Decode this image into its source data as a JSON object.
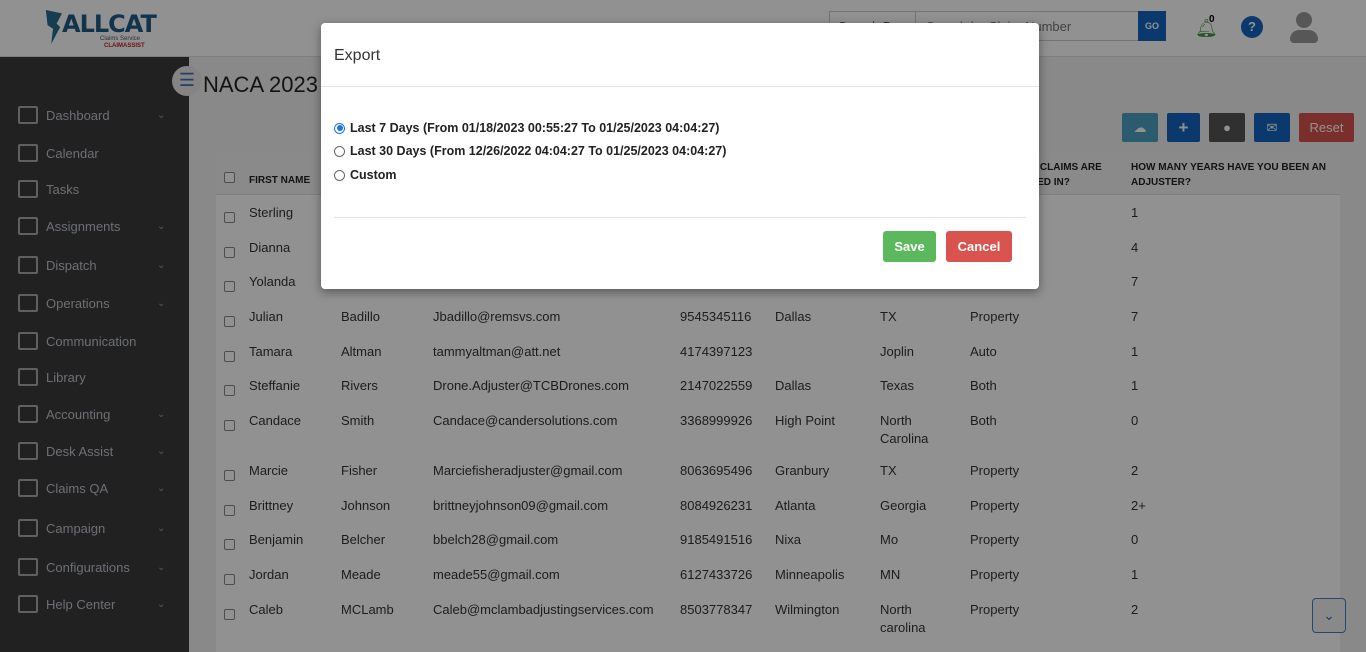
{
  "header": {
    "logo_text": "ALLCAT",
    "logo_sub": "Claims Service",
    "logo_sub2": "CLAIMASSIST",
    "search_by": "Search By",
    "search_placeholder": "Search by Claim Number",
    "go_label": "GO",
    "notification_count": "0",
    "help_label": "?"
  },
  "sidebar": {
    "items": [
      {
        "label": "Dashboard",
        "chevron": true,
        "icon": "dashboard-icon"
      },
      {
        "label": "Calendar",
        "chevron": false,
        "icon": "calendar-icon"
      },
      {
        "label": "Tasks",
        "chevron": false,
        "icon": "tasks-icon"
      },
      {
        "label": "Assignments",
        "chevron": true,
        "icon": "clipboard-icon"
      },
      {
        "label": "Dispatch",
        "chevron": true,
        "icon": "dispatch-icon"
      },
      {
        "label": "Operations",
        "chevron": true,
        "icon": "operations-icon"
      },
      {
        "label": "Communication",
        "chevron": false,
        "icon": "globe-icon"
      },
      {
        "label": "Library",
        "chevron": false,
        "icon": "library-icon"
      },
      {
        "label": "Accounting",
        "chevron": true,
        "icon": "accounting-icon"
      },
      {
        "label": "Desk Assist",
        "chevron": true,
        "icon": "desk-icon"
      },
      {
        "label": "Claims QA",
        "chevron": true,
        "icon": "claims-qa-icon"
      },
      {
        "label": "Campaign",
        "chevron": true,
        "icon": "megaphone-icon"
      },
      {
        "label": "Configurations",
        "chevron": true,
        "icon": "gear-icon"
      },
      {
        "label": "Help Center",
        "chevron": true,
        "icon": "help-icon"
      }
    ]
  },
  "main": {
    "title": "NACA 2023",
    "reset_label": "Reset",
    "columns": [
      "FIRST NAME",
      "F CLAIMS ARE",
      "TED IN?",
      "HOW MANY YEARS HAVE YOU BEEN AN",
      "ADJUSTER?"
    ],
    "rows": [
      {
        "first": "Sterling",
        "last": "",
        "email": "",
        "phone": "",
        "city": "",
        "state": "",
        "type": "",
        "years": "1"
      },
      {
        "first": "Dianna",
        "last": "",
        "email": "",
        "phone": "",
        "city": "",
        "state": "",
        "type": "",
        "years": "4"
      },
      {
        "first": "Yolanda",
        "last": "",
        "email": "",
        "phone": "",
        "city": "",
        "state": "",
        "type": "",
        "years": "7"
      },
      {
        "first": "Julian",
        "last": "Badillo",
        "email": "Jbadillo@remsvs.com",
        "phone": "9545345116",
        "city": "Dallas",
        "state": "TX",
        "type": "Property",
        "years": "7"
      },
      {
        "first": "Tamara",
        "last": "Altman",
        "email": "tammyaltman@att.net",
        "phone": "4174397123",
        "city": "",
        "state": "Joplin",
        "type": "Auto",
        "years": "1"
      },
      {
        "first": "Steffanie",
        "last": "Rivers",
        "email": "Drone.Adjuster@TCBDrones.com",
        "phone": "2147022559",
        "city": "Dallas",
        "state": "Texas",
        "type": "Both",
        "years": "1"
      },
      {
        "first": "Candace",
        "last": "Smith",
        "email": "Candace@candersolutions.com",
        "phone": "3368999926",
        "city": "High Point",
        "state": "North Carolina",
        "type": "Both",
        "years": "0"
      },
      {
        "first": "Marcie",
        "last": "Fisher",
        "email": "Marciefisheradjuster@gmail.com",
        "phone": "8063695496",
        "city": "Granbury",
        "state": "TX",
        "type": "Property",
        "years": "2"
      },
      {
        "first": "Brittney",
        "last": "Johnson",
        "email": "brittneyjohnson09@gmail.com",
        "phone": "8084926231",
        "city": "Atlanta",
        "state": "Georgia",
        "type": "Property",
        "years": "2+"
      },
      {
        "first": "Benjamin",
        "last": "Belcher",
        "email": "bbelch28@gmail.com",
        "phone": "9185491516",
        "city": "Nixa",
        "state": "Mo",
        "type": "Property",
        "years": "0"
      },
      {
        "first": "Jordan",
        "last": "Meade",
        "email": "meade55@gmail.com",
        "phone": "6127433726",
        "city": "Minneapolis",
        "state": "MN",
        "type": "Property",
        "years": "1"
      },
      {
        "first": "Caleb",
        "last": "MCLamb",
        "email": "Caleb@mclambadjustingservices.com",
        "phone": "8503778347",
        "city": "Wilmington",
        "state": "North carolina",
        "type": "Property",
        "years": "2"
      }
    ]
  },
  "modal": {
    "title": "Export",
    "options": [
      {
        "label": "Last 7 Days (From 01/18/2023 00:55:27 To 01/25/2023 04:04:27)",
        "selected": true
      },
      {
        "label": "Last 30 Days (From 12/26/2022 04:04:27 To 01/25/2023 04:04:27)",
        "selected": false
      },
      {
        "label": "Custom",
        "selected": false
      }
    ],
    "save_label": "Save",
    "cancel_label": "Cancel"
  },
  "colors": {
    "save": "#5cb85c",
    "cancel": "#d9534f",
    "primary": "#1565c0",
    "export": "#4aa3c0"
  }
}
